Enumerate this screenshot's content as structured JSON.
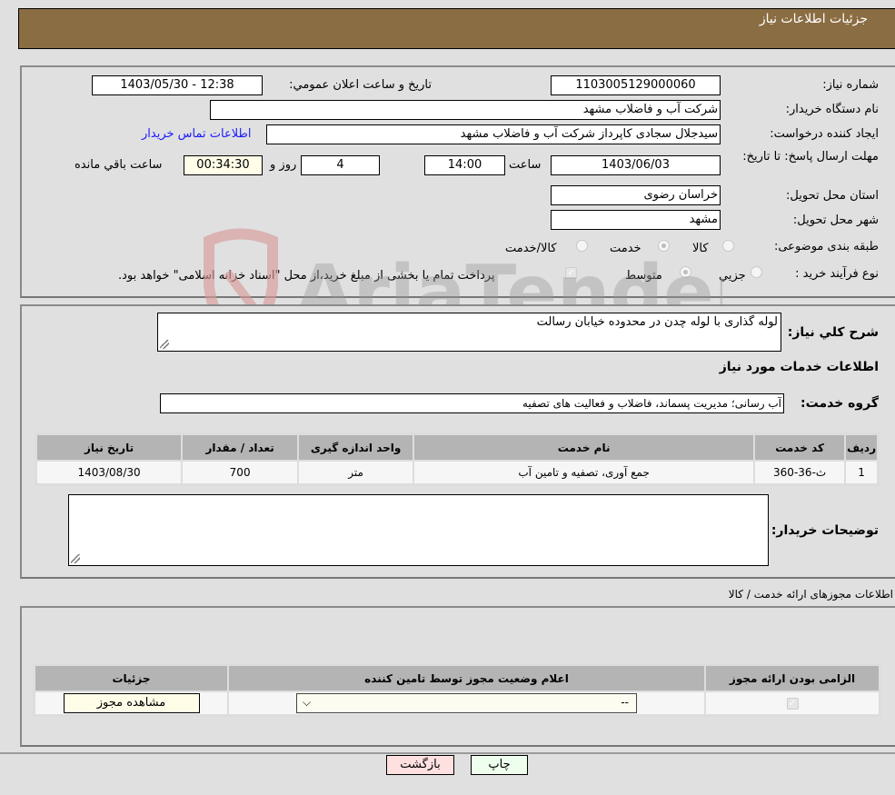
{
  "header": {
    "title": "جزئیات اطلاعات نیاز"
  },
  "form": {
    "need_number": {
      "label": "شماره نیاز:",
      "value": "1103005129000060"
    },
    "announce": {
      "label": "تاريخ و ساعت اعلان عمومي:",
      "value": "1403/05/30 - 12:38"
    },
    "buyer_org": {
      "label": "نام دستگاه خریدار:",
      "value": "شرکت آب و فاضلاب مشهد"
    },
    "creator": {
      "label": "ایجاد کننده درخواست:",
      "value": "سیدجلال سجادی کاپرداز شرکت آب و فاضلاب مشهد"
    },
    "contact_link": "اطلاعات تماس خریدار",
    "deadline": {
      "label": "مهلت ارسال پاسخ: تا تاریخ:",
      "date": "1403/06/03",
      "time_label": "ساعت",
      "time": "14:00",
      "days": "4",
      "days_label": "روز و",
      "remaining": "00:34:30",
      "remaining_label": "ساعت باقي مانده"
    },
    "province": {
      "label": "استان محل تحویل:",
      "value": "خراسان رضوی"
    },
    "city": {
      "label": "شهر محل تحویل:",
      "value": "مشهد"
    },
    "category": {
      "label": "طبقه بندی موضوعی:",
      "options": [
        "کالا",
        "خدمت",
        "کالا/خدمت"
      ],
      "selected": "خدمت"
    },
    "process": {
      "label": "نوع فرآیند خرید :",
      "options": [
        "جزيي",
        "متوسط"
      ],
      "selected": "متوسط",
      "treasury_note": "پرداخت تمام یا بخشی از مبلغ خرید،از محل \"اسناد خزانه اسلامی\" خواهد بود.",
      "treasury_checked": true
    }
  },
  "description": {
    "label": "شرح کلي نياز:",
    "value": "لوله گذاری با لوله چدن در محدوده خیابان رسالت"
  },
  "services": {
    "section_title": "اطلاعات خدمات مورد نیاز",
    "group_label": "گروه خدمت:",
    "group_value": "آب رسانی؛ مدیریت پسماند، فاضلاب و فعالیت های تصفیه",
    "columns": [
      "رديف",
      "کد خدمت",
      "نام خدمت",
      "واحد اندازه گیری",
      "تعداد / مقدار",
      "تاریخ نیاز"
    ],
    "rows": [
      [
        "1",
        "ث-36-360",
        "جمع آوری، تصفیه و تامین آب",
        "متر",
        "700",
        "1403/08/30"
      ]
    ]
  },
  "buyer_notes": {
    "label": "توضیحات خریدار:",
    "value": ""
  },
  "permits": {
    "section_title": "اطلاعات مجوزهای ارائه خدمت / کالا",
    "columns": [
      "الزامی بودن ارائه مجوز",
      "اعلام وضعیت مجوز توسط تامین کننده",
      "جزئیات"
    ],
    "rows": [
      {
        "required": true,
        "status": "--",
        "details_button": "مشاهده مجوز"
      }
    ]
  },
  "footer": {
    "print_label": "چاپ",
    "back_label": "بازگشت"
  },
  "colors": {
    "header_bg": "#8b6d43",
    "print_bg": "#eeffee",
    "back_bg": "#ffe0e0"
  }
}
